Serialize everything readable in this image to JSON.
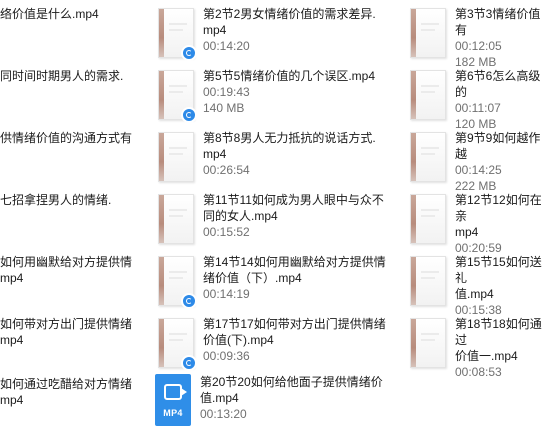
{
  "files": [
    {
      "name": "络价值是什么.mp4",
      "duration": "",
      "size": ""
    },
    {
      "name": "第2节2男女情绪价值的需求差异.\nmp4",
      "duration": "00:14:20",
      "size": ""
    },
    {
      "name": "第3节3情绪价值有",
      "duration": "00:12:05",
      "size": "182 MB"
    },
    {
      "name": "同时间时期男人的需求.",
      "duration": "",
      "size": ""
    },
    {
      "name": "第5节5情绪价值的几个误区.mp4",
      "duration": "00:19:43",
      "size": "140 MB"
    },
    {
      "name": "第6节6怎么高级的",
      "duration": "00:11:07",
      "size": "120 MB"
    },
    {
      "name": "供情绪价值的沟通方式有",
      "duration": "",
      "size": ""
    },
    {
      "name": "第8节8男人无力抵抗的说话方式.\nmp4",
      "duration": "00:26:54",
      "size": ""
    },
    {
      "name": "第9节9如何越作越",
      "duration": "00:14:25",
      "size": "222 MB"
    },
    {
      "name": "七招拿捏男人的情绪.",
      "duration": "",
      "size": ""
    },
    {
      "name": "第11节11如何成为男人眼中与众不\n同的女人.mp4",
      "duration": "00:15:52",
      "size": ""
    },
    {
      "name": "第12节12如何在亲\nmp4",
      "duration": "00:20:59",
      "size": ""
    },
    {
      "name": "如何用幽默给对方提供情\nmp4",
      "duration": "",
      "size": ""
    },
    {
      "name": "第14节14如何用幽默给对方提供情\n绪价值（下）.mp4",
      "duration": "00:14:19",
      "size": ""
    },
    {
      "name": "第15节15如何送礼\n值.mp4",
      "duration": "00:15:38",
      "size": ""
    },
    {
      "name": "如何带对方出门提供情绪\nmp4",
      "duration": "",
      "size": ""
    },
    {
      "name": "第17节17如何带对方出门提供情绪\n价值(下).mp4",
      "duration": "00:09:36",
      "size": ""
    },
    {
      "name": "第18节18如何通过\n价值一.mp4",
      "duration": "00:08:53",
      "size": ""
    },
    {
      "name": "如何通过吃醋给对方情绪\nmp4",
      "duration": "",
      "size": ""
    },
    {
      "name": "第20节20如何给他面子提供情绪价\n值.mp4",
      "duration": "00:13:20",
      "size": "",
      "icon_label": "MP4",
      "icon": "mp4-video-icon"
    }
  ],
  "colors": {
    "accent": "#2f8ee8",
    "badge": "#2d8ae8"
  }
}
